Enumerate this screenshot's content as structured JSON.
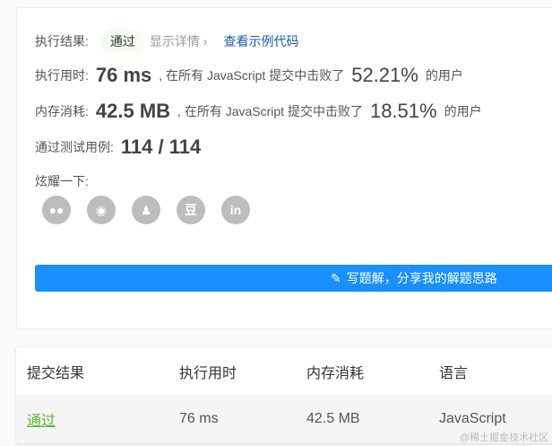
{
  "result": {
    "label": "执行结果:",
    "status": "通过",
    "details": "显示详情 ›",
    "example": "查看示例代码"
  },
  "time": {
    "label": "执行用时:",
    "value": "76 ms",
    "mid": ", 在所有 JavaScript 提交中击败了",
    "percent": "52.21%",
    "suffix": "的用户"
  },
  "memory": {
    "label": "内存消耗:",
    "value": "42.5 MB",
    "mid": ", 在所有 JavaScript 提交中击败了",
    "percent": "18.51%",
    "suffix": "的用户"
  },
  "tests": {
    "label": "通过测试用例:",
    "value": "114 / 114"
  },
  "share": {
    "label": "炫耀一下:",
    "icons": [
      "wechat-icon",
      "weibo-icon",
      "qq-icon",
      "douban-icon",
      "linkedin-icon"
    ]
  },
  "solution_button": "写题解，分享我的解题思路",
  "table": {
    "headers": [
      "提交结果",
      "执行用时",
      "内存消耗",
      "语言"
    ],
    "row": [
      "通过",
      "76 ms",
      "42.5 MB",
      "JavaScript"
    ]
  },
  "watermark": "@稀土掘金技术社区",
  "colors": {
    "accent": "#1890ff",
    "success": "#5cb82a"
  }
}
